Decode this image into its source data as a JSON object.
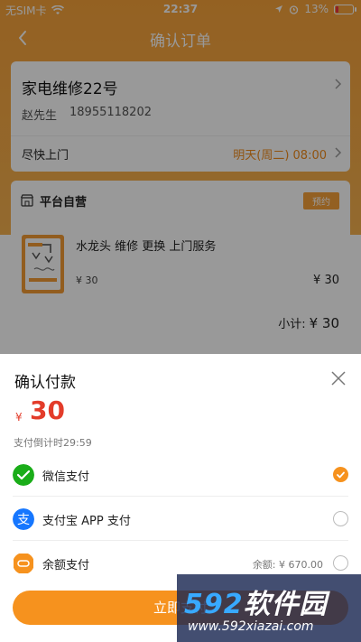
{
  "status_bar": {
    "carrier": "无SIM卡",
    "time": "22:37",
    "battery": "13%"
  },
  "nav": {
    "title": "确认订单"
  },
  "address": {
    "name": "家电维修22号",
    "contact_name": "赵先生",
    "phone": "18955118202",
    "delivery_label": "尽快上门",
    "delivery_time": "明天(周二) 08:00"
  },
  "shop": {
    "name": "平台自营",
    "badge": "预约",
    "product_name": "水龙头 维修 更换 上门服务",
    "unit_price": "¥ 30",
    "line_price": "¥ 30",
    "subtotal_label": "小计:",
    "subtotal_amount": "¥ 30"
  },
  "payment_sheet": {
    "title": "确认付款",
    "currency": "¥",
    "amount": "30",
    "countdown": "支付倒计时29:59",
    "methods": [
      {
        "label": "微信支付",
        "selected": true,
        "icon": "wechat-pay-icon",
        "color": "#1aad19"
      },
      {
        "label": "支付宝 APP 支付",
        "selected": false,
        "icon": "alipay-icon",
        "color": "#1677ff"
      },
      {
        "label": "余额支付",
        "selected": false,
        "icon": "wallet-icon",
        "color": "#f6921e",
        "balance": "余额: ¥ 670.00"
      }
    ],
    "confirm_label": "立即支付"
  },
  "watermark": {
    "big_prefix": "592",
    "big_suffix": "软件园",
    "url": "www.592xiazai.com"
  },
  "colors": {
    "accent": "#f6921e",
    "price_red": "#e33c2a"
  }
}
